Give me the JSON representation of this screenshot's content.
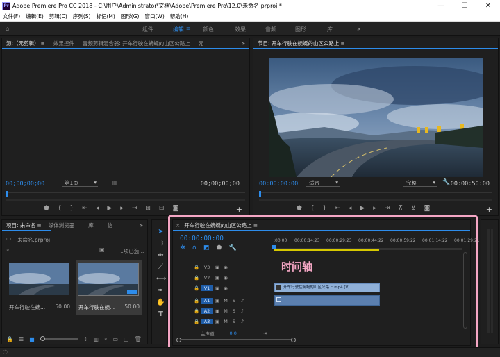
{
  "window": {
    "title": "Adobe Premiere Pro CC 2018 - C:\\用户\\Administrator\\文档\\Adobe\\Premiere Pro\\12.0\\未命名.prproj *",
    "logo_text": "Pr",
    "minimize": "—",
    "maximize": "☐",
    "close": "✕"
  },
  "menu": [
    "文件(F)",
    "编辑(E)",
    "剪辑(C)",
    "序列(S)",
    "标记(M)",
    "图形(G)",
    "窗口(W)",
    "帮助(H)"
  ],
  "workspaces": [
    "组件",
    "编辑",
    "颜色",
    "效果",
    "音频",
    "图形",
    "库"
  ],
  "workspace_active": "编辑",
  "workspace_more": "»",
  "source_panel": {
    "tabs": [
      "源:（无剪辑）",
      "效果控件",
      "音频剪辑混合器: 开车行驶在蜿蜒的山区公路上",
      "元"
    ],
    "more": "»",
    "timecode_left": "00;00;00;00",
    "page_select": "第1页",
    "timecode_right": "00;00;00;00"
  },
  "program_panel": {
    "title": "节目: 开车行驶在蜿蜒的山区公路上",
    "timecode_left": "00:00:00:00",
    "fit_select": "适合",
    "quality_select": "完整",
    "timecode_right": "00:00:50:00"
  },
  "project_panel": {
    "tabs": [
      "项目: 未命名",
      "媒体浏览器",
      "库",
      "信"
    ],
    "more": "»",
    "project_file": "未命名.prproj",
    "selection_info": "1项已选...",
    "items": [
      {
        "name": "开车行驶在蜿...",
        "duration": "50:00"
      },
      {
        "name": "开车行驶在蜿...",
        "duration": "50:00"
      }
    ]
  },
  "timeline_panel": {
    "title": "开车行驶在蜿蜒的山区公路上",
    "timecode": "00:00:00:00",
    "ruler": [
      ":00:00",
      "00:00:14:23",
      "00:00:29:23",
      "00:00:44:22",
      "00:00:59:22",
      "00:01:14:22",
      "00:01:29:21"
    ],
    "annotation": "时间轴",
    "video_tracks": [
      "V3",
      "V2",
      "V1"
    ],
    "audio_tracks": [
      "A1",
      "A2",
      "A3"
    ],
    "mute_label": "M",
    "solo_label": "S",
    "master_label": "主声道",
    "master_value": "0.0",
    "clip_video": "开车行驶在蜿蜒的山区公路上.mp4 [V]",
    "highlight_color": "#f4a6c4",
    "accent_color": "#2d8ceb"
  },
  "playhead_fraction_source": 0.0,
  "playhead_fraction_program": 0.0
}
